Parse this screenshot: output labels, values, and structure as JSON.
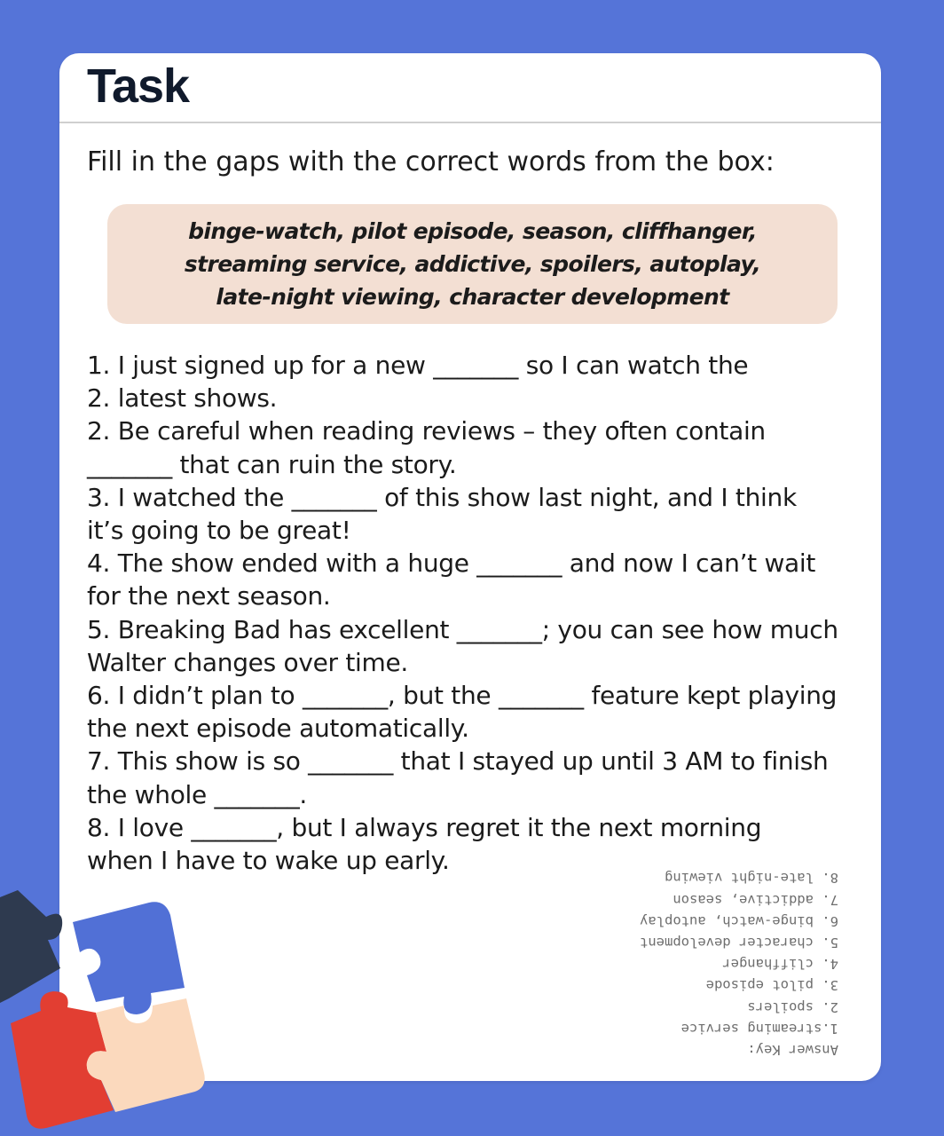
{
  "task": {
    "title": "Task",
    "instruction": "Fill in the gaps with the correct words from the box:",
    "word_box_lines": [
      "binge-watch, pilot episode, season, cliffhanger,",
      "streaming service, addictive, spoilers, autoplay,",
      "late-night viewing, character development"
    ],
    "exercise_lines": [
      "1. I just signed up for a new _______ so I can watch the",
      "2. latest shows.",
      "2. Be careful when reading reviews – they often contain",
      "_______ that can ruin the story.",
      "3. I watched the _______ of this show last night, and I think",
      "it’s going to be great!",
      "4. The show ended with a huge _______ and now I can’t wait",
      "for the next season.",
      "5. Breaking Bad has excellent _______; you can see how much",
      "Walter changes over time.",
      "6. I didn’t plan to _______, but the _______ feature kept playing",
      "the next episode automatically.",
      "7. This show is so _______ that I stayed up until 3 AM to finish",
      "the whole _______.",
      "8. I love _______, but I always regret it the next morning",
      "when I have to wake up early."
    ],
    "answer_key_lines": [
      "Answer Key:",
      "1.streaming service",
      "2. spoilers",
      "3. pilot episode",
      "4. cliffhanger",
      "5. character development",
      "6. binge-watch, autoplay",
      "7. addictive, season",
      "8. late-night viewing"
    ]
  },
  "colors": {
    "background": "#5574d8",
    "card": "#ffffff",
    "word_box": "#f3dfd3",
    "puzzle_navy": "#2e3a4f",
    "puzzle_blue": "#5170d6",
    "puzzle_red": "#e23e32",
    "puzzle_peach": "#fbd9bd"
  },
  "icons": {
    "decoration": "puzzle-pieces-icon"
  }
}
